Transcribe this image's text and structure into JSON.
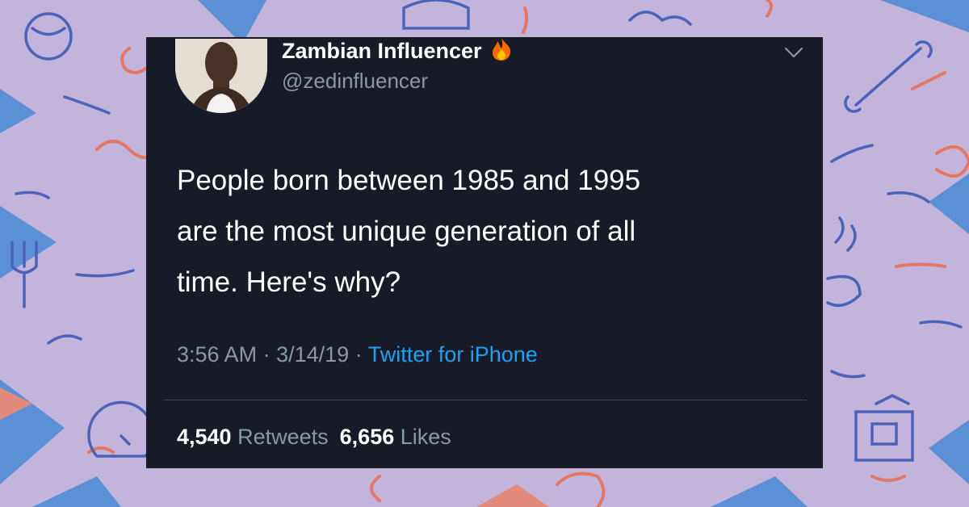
{
  "tweet": {
    "display_name": "Zambian Influencer",
    "name_emoji": "fire-icon",
    "handle": "@zedinfluencer",
    "lines": [
      "People born between 1985 and 1995",
      "are the most unique generation of all",
      "time. Here's why?"
    ],
    "time": "3:56 AM",
    "date": "3/14/19",
    "separator": "·",
    "source": "Twitter for iPhone",
    "retweets_count": "4,540",
    "retweets_label": "Retweets",
    "likes_count": "6,656",
    "likes_label": "Likes"
  },
  "colors": {
    "background": "#c3b4dc",
    "card": "#161b27",
    "link": "#1da1f2",
    "muted": "#8b98a5"
  }
}
